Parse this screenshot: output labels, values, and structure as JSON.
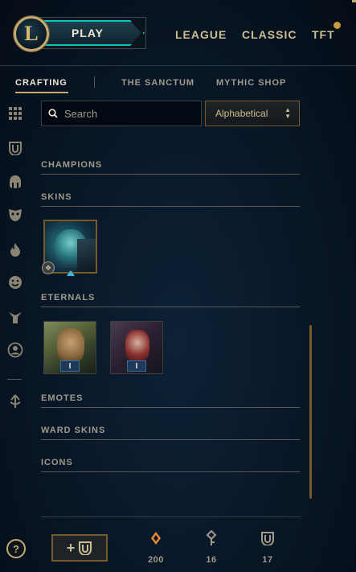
{
  "topbar": {
    "logo_letter": "L",
    "play_label": "PLAY",
    "nav": {
      "league": "LEAGUE",
      "classic": "CLASSIC",
      "tft": "TFT"
    }
  },
  "subnav": {
    "crafting": "CRAFTING",
    "sanctum": "THE SANCTUM",
    "mythic_shop": "MYTHIC SHOP"
  },
  "sidebar": {
    "icons": [
      "grid-icon",
      "chest-icon",
      "champion-helmet-icon",
      "skin-mask-icon",
      "flame-icon",
      "emote-face-icon",
      "ward-icon",
      "profile-icon",
      "eternal-arrow-icon"
    ],
    "help_label": "?"
  },
  "search": {
    "placeholder": "Search",
    "value": ""
  },
  "sort": {
    "selected": "Alphabetical"
  },
  "sections": {
    "champions": "CHAMPIONS",
    "skins": "SKINS",
    "eternals": "ETERNALS",
    "emotes": "EMOTES",
    "ward_skins": "WARD SKINS",
    "icons": "ICONS"
  },
  "eternals": [
    {
      "label": "I"
    },
    {
      "label": "I"
    }
  ],
  "footer": {
    "add_symbol": "+",
    "essence_count": "200",
    "keys_count": "16",
    "chests_count": "17"
  },
  "colors": {
    "gold": "#c8aa6e",
    "teal": "#0ac8b9",
    "orange_essence": "#f08a2e",
    "background": "#081625"
  }
}
